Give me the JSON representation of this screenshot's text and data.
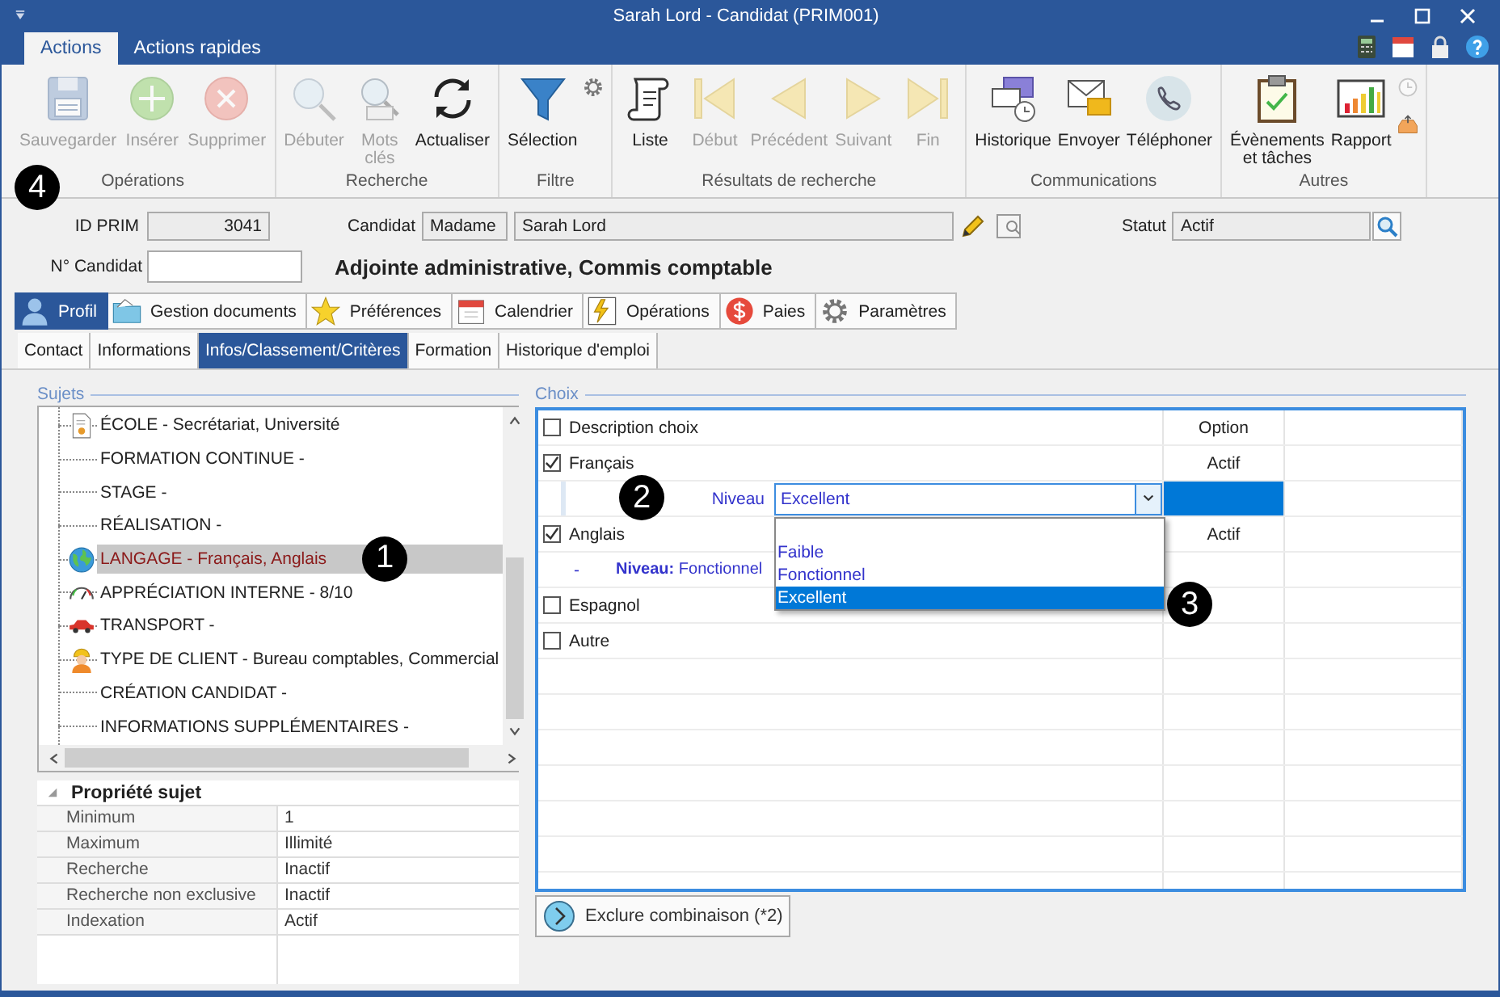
{
  "window": {
    "title": "Sarah Lord - Candidat (PRIM001)"
  },
  "ribbon": {
    "tabs": [
      {
        "label": "Actions",
        "selected": true
      },
      {
        "label": "Actions rapides",
        "selected": false
      }
    ],
    "groups": [
      {
        "label": "Opérations",
        "callout": "4",
        "buttons": [
          {
            "label": "Sauvegarder",
            "kind": "save",
            "disabled": true
          },
          {
            "label": "Insérer",
            "kind": "insert",
            "disabled": true
          },
          {
            "label": "Supprimer",
            "kind": "delete",
            "disabled": true
          }
        ]
      },
      {
        "label": "Recherche",
        "buttons": [
          {
            "label": "Débuter",
            "kind": "search",
            "disabled": true
          },
          {
            "label": "Mots clés",
            "kind": "keywords",
            "disabled": true
          },
          {
            "label": "Actualiser",
            "kind": "refresh",
            "disabled": false
          }
        ]
      },
      {
        "label": "Filtre",
        "buttons": [
          {
            "label": "Sélection",
            "kind": "filter",
            "disabled": false
          }
        ],
        "small_buttons": [
          {
            "kind": "gear",
            "disabled": false
          }
        ]
      },
      {
        "label": "Résultats de recherche",
        "buttons": [
          {
            "label": "Liste",
            "kind": "list",
            "disabled": false
          },
          {
            "label": "Début",
            "kind": "first",
            "disabled": true
          },
          {
            "label": "Précédent",
            "kind": "previous",
            "disabled": true
          },
          {
            "label": "Suivant",
            "kind": "next",
            "disabled": true
          },
          {
            "label": "Fin",
            "kind": "last",
            "disabled": true
          }
        ]
      },
      {
        "label": "Communications",
        "buttons": [
          {
            "label": "Historique",
            "kind": "history",
            "disabled": false
          },
          {
            "label": "Envoyer",
            "kind": "mail",
            "disabled": false
          },
          {
            "label": "Téléphoner",
            "kind": "phone",
            "disabled": false
          }
        ]
      },
      {
        "label": "Autres",
        "buttons": [
          {
            "label": "Évènements et tâches",
            "kind": "tasks",
            "disabled": false
          },
          {
            "label": "Rapport",
            "kind": "report",
            "disabled": false
          }
        ],
        "small_buttons": [
          {
            "kind": "clock",
            "disabled": true
          },
          {
            "kind": "inbox",
            "disabled": false
          }
        ]
      }
    ]
  },
  "record": {
    "id_label": "ID PRIM",
    "id": "3041",
    "candidate_label": "Candidat",
    "salutation": "Madame",
    "name": "Sarah Lord",
    "status_label": "Statut",
    "status": "Actif",
    "number_label": "N° Candidat",
    "position": "Adjointe administrative, Commis comptable"
  },
  "main_tabs": [
    {
      "label": "Profil",
      "kind": "person",
      "selected": true
    },
    {
      "label": "Gestion documents",
      "kind": "folder",
      "selected": false
    },
    {
      "label": "Préférences",
      "kind": "star",
      "selected": false
    },
    {
      "label": "Calendrier",
      "kind": "calendar",
      "selected": false
    },
    {
      "label": "Opérations",
      "kind": "bolt",
      "selected": false
    },
    {
      "label": "Paies",
      "kind": "dollar",
      "selected": false
    },
    {
      "label": "Paramètres",
      "kind": "gear",
      "selected": false
    }
  ],
  "sub_tabs": [
    {
      "label": "Contact",
      "selected": false
    },
    {
      "label": "Informations",
      "selected": false
    },
    {
      "label": "Infos/Classement/Critères",
      "selected": true
    },
    {
      "label": "Formation",
      "selected": false
    },
    {
      "label": "Historique d'emploi",
      "selected": false
    }
  ],
  "subjects": {
    "title": "Sujets",
    "items": [
      {
        "label": "ÉCOLE - Secrétariat, Université",
        "kind": "document",
        "selected": false
      },
      {
        "label": "FORMATION CONTINUE -",
        "kind": "none",
        "selected": false
      },
      {
        "label": "STAGE -",
        "kind": "none",
        "selected": false
      },
      {
        "label": "RÉALISATION -",
        "kind": "none",
        "selected": false
      },
      {
        "label": "LANGAGE - Français, Anglais",
        "kind": "globe",
        "selected": true,
        "callout": "1"
      },
      {
        "label": "APPRÉCIATION INTERNE - 8/10",
        "kind": "gauge",
        "selected": false
      },
      {
        "label": "TRANSPORT -",
        "kind": "car",
        "selected": false
      },
      {
        "label": "TYPE DE CLIENT - Bureau comptables, Commercial",
        "kind": "worker",
        "selected": false
      },
      {
        "label": "CRÉATION CANDIDAT -",
        "kind": "none",
        "selected": false
      },
      {
        "label": "INFORMATIONS SUPPLÉMENTAIRES -",
        "kind": "none",
        "selected": false
      }
    ]
  },
  "properties": {
    "title": "Propriété sujet",
    "expanded": true,
    "rows": [
      {
        "name": "Minimum",
        "value": "1"
      },
      {
        "name": "Maximum",
        "value": "Illimité"
      },
      {
        "name": "Recherche",
        "value": "Inactif"
      },
      {
        "name": "Recherche non exclusive",
        "value": "Inactif"
      },
      {
        "name": "Indexation",
        "value": "Actif"
      }
    ]
  },
  "choices": {
    "title": "Choix",
    "columns": [
      "Description choix",
      "Option"
    ],
    "header_checked": false,
    "rows": [
      {
        "kind": "choice",
        "label": "Français",
        "checked": true,
        "option": "Actif"
      },
      {
        "kind": "editor",
        "label": "Niveau",
        "value": "Excellent",
        "callout": "2",
        "options": [
          {
            "label": "Faible",
            "selected": false
          },
          {
            "label": "Fonctionnel",
            "selected": false
          },
          {
            "label": "Excellent",
            "selected": true,
            "callout": "3"
          }
        ]
      },
      {
        "kind": "choice",
        "label": "Anglais",
        "checked": true,
        "option": "Actif"
      },
      {
        "kind": "detail",
        "dash": "-",
        "text": "**Niveau:** Fonctionnel"
      },
      {
        "kind": "choice",
        "label": "Espagnol",
        "checked": false
      },
      {
        "kind": "choice",
        "label": "Autre",
        "checked": false
      }
    ]
  },
  "exclude_button": {
    "label": "Exclure combinaison (*2)"
  }
}
